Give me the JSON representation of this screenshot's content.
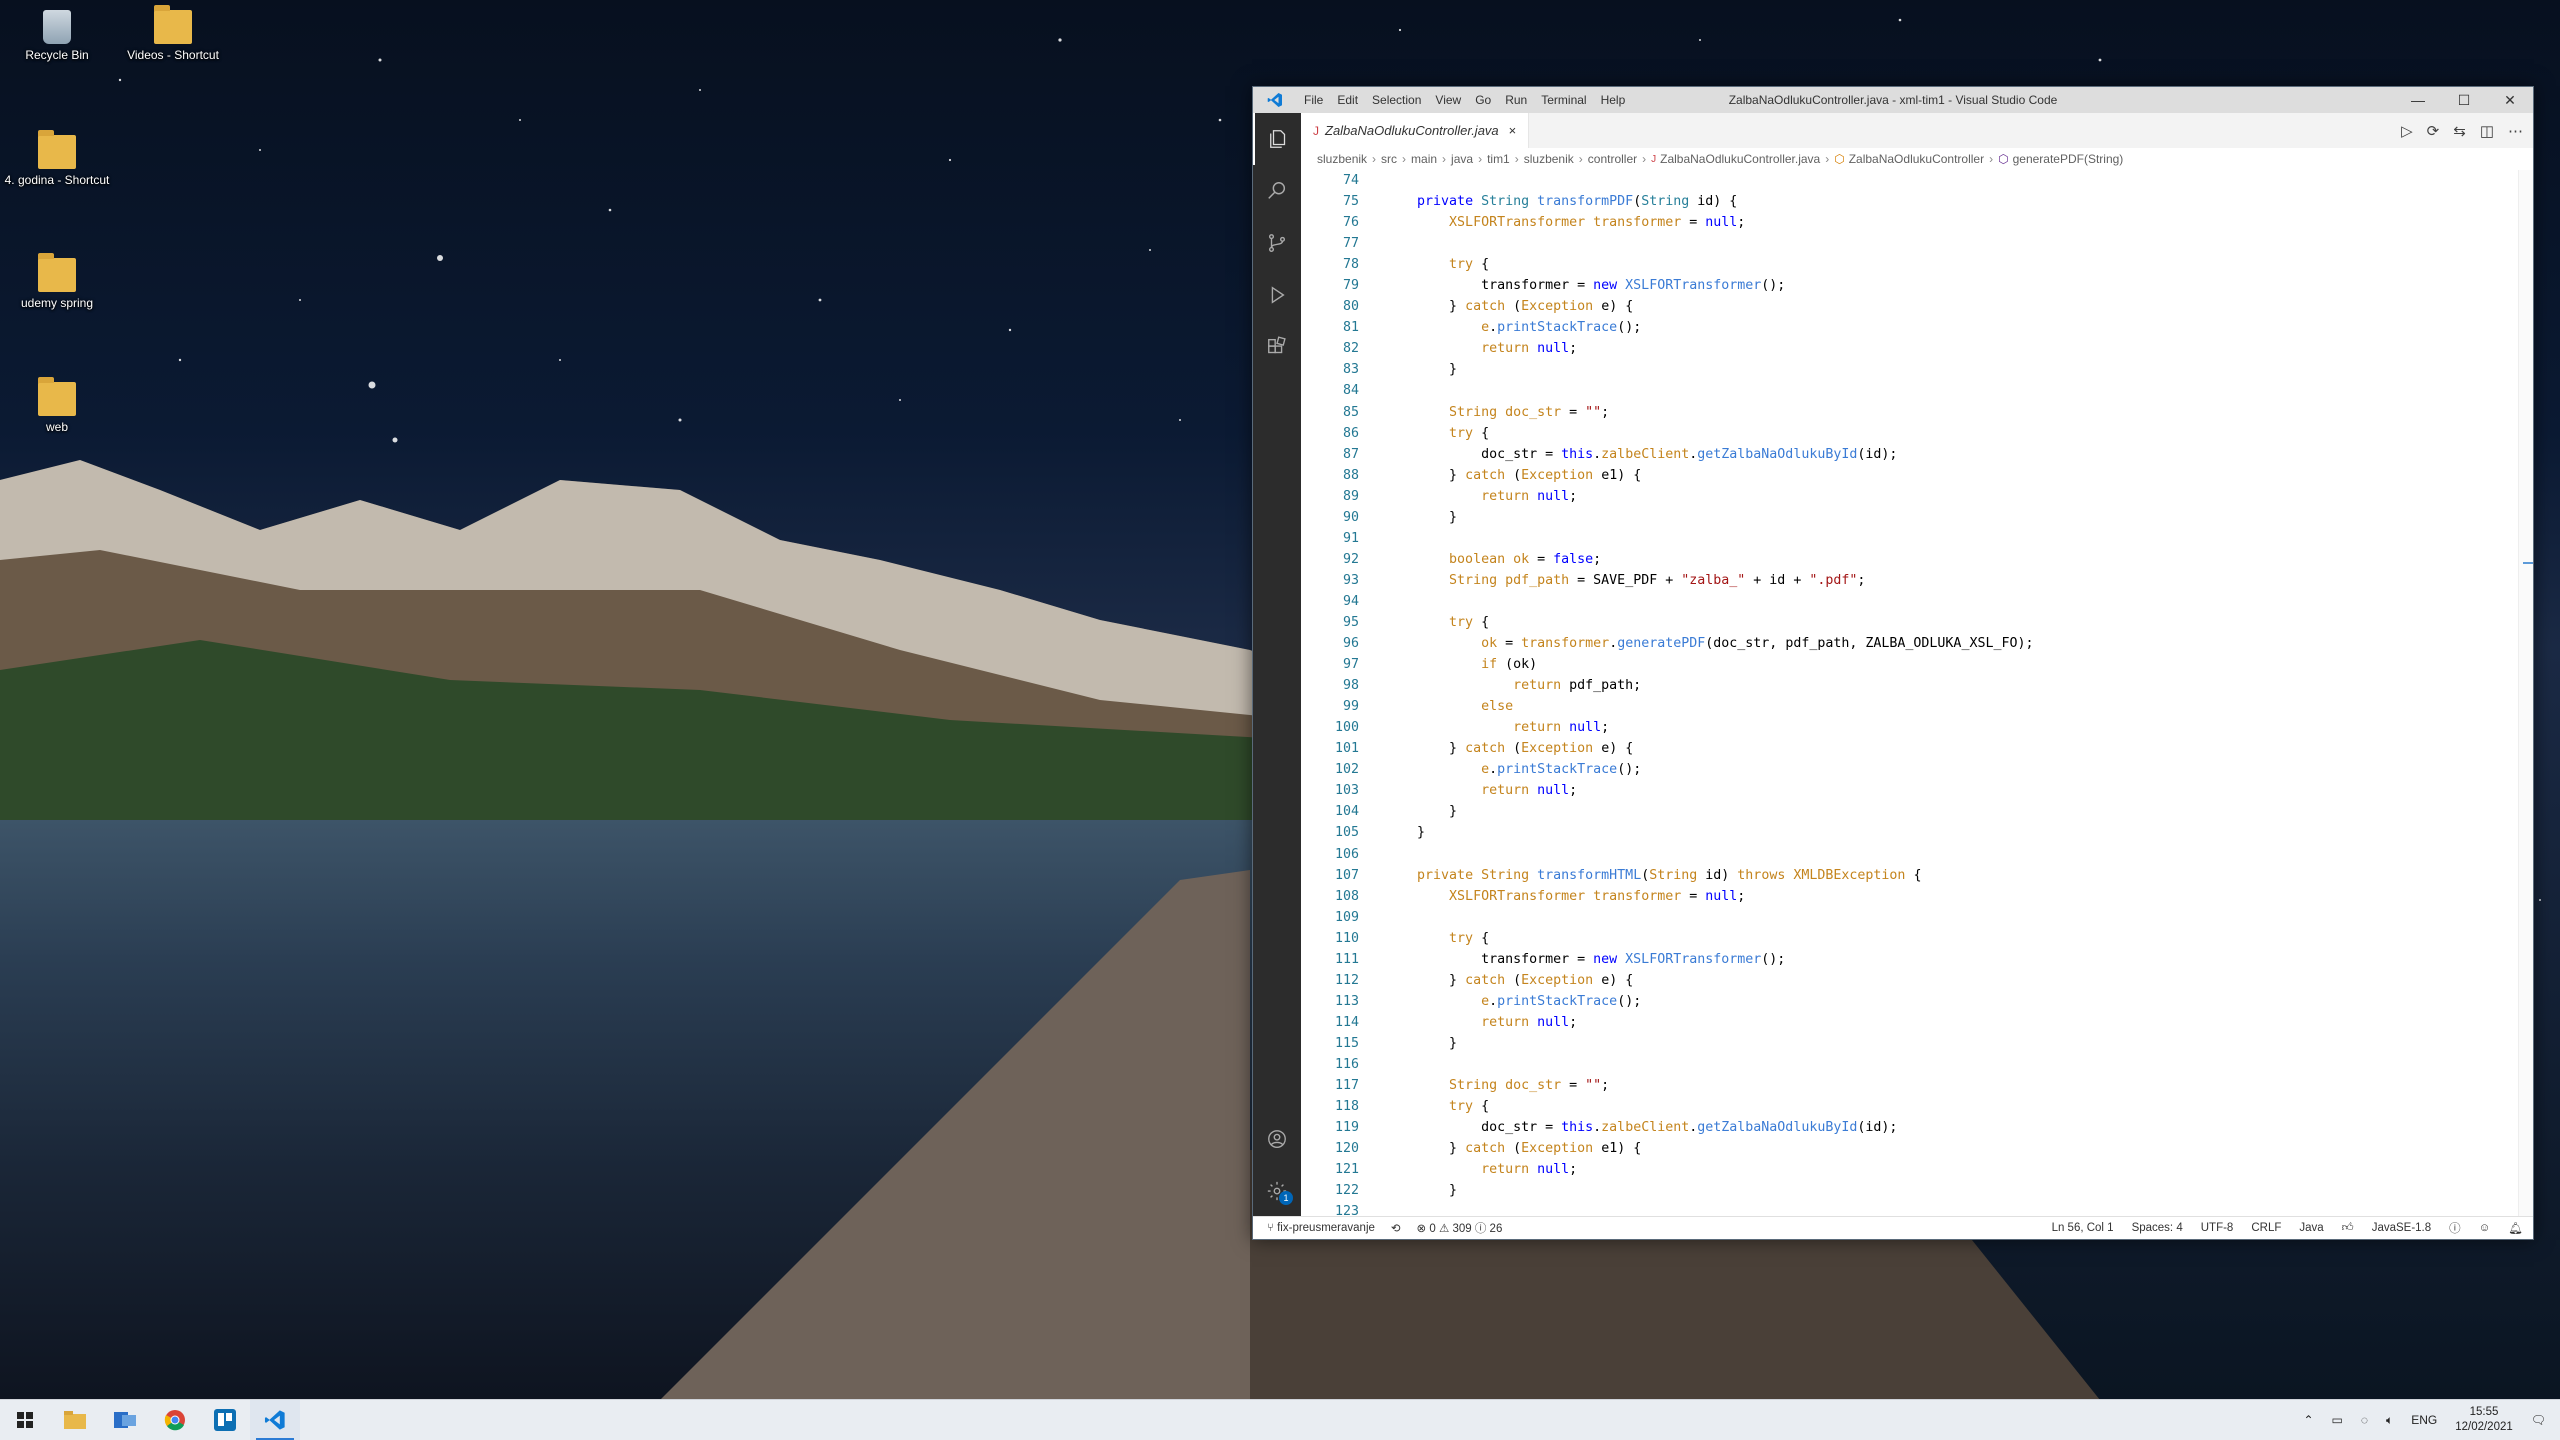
{
  "desktop": {
    "icons": [
      {
        "label": "Recycle Bin"
      },
      {
        "label": "Videos - Shortcut"
      },
      {
        "label": "4. godina - Shortcut"
      },
      {
        "label": "udemy spring"
      },
      {
        "label": "web"
      }
    ]
  },
  "window": {
    "title": "ZalbaNaOdlukuController.java - xml-tim1 - Visual Studio Code",
    "menu": [
      "File",
      "Edit",
      "Selection",
      "View",
      "Go",
      "Run",
      "Terminal",
      "Help"
    ],
    "controls": {
      "minimize": "—",
      "maximize": "☐",
      "close": "✕"
    }
  },
  "tab": {
    "label": "ZalbaNaOdlukuController.java",
    "close": "×",
    "icon": "J"
  },
  "breadcrumbs": [
    "sluzbenik",
    "src",
    "main",
    "java",
    "tim1",
    "sluzbenik",
    "controller",
    "ZalbaNaOdlukuController.java",
    "ZalbaNaOdlukuController",
    "generatePDF(String)"
  ],
  "code": {
    "first_line": 74
  },
  "statusbar": {
    "branch": "fix-preusmeravanje",
    "problems": "⊗ 0 ⚠ 309 ⓘ 26",
    "position": "Ln 56, Col 1",
    "spaces": "Spaces: 4",
    "encoding": "UTF-8",
    "eol": "CRLF",
    "language": "Java",
    "jdk": "JavaSE-1.8"
  },
  "taskbar": {
    "language": "ENG",
    "time": "15:55",
    "date": "12/02/2021"
  },
  "colors": {
    "activitybar": "#2c2c2c",
    "accent": "#0066b8",
    "keyword": "#0000ff",
    "control": "#af00db",
    "type": "#267f99",
    "string": "#a31515"
  }
}
